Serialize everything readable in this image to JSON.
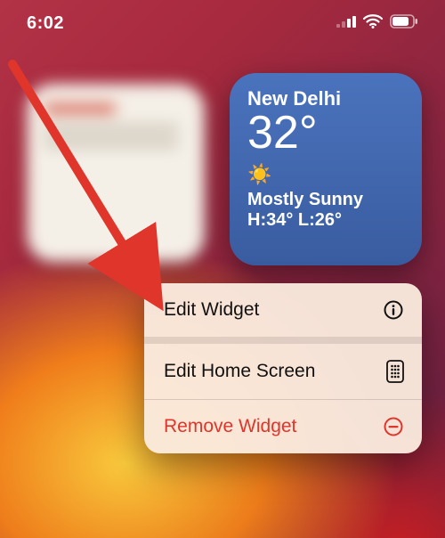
{
  "statusbar": {
    "time": "6:02"
  },
  "widgets": {
    "weather": {
      "city": "New Delhi",
      "temp": "32°",
      "condition": "Mostly Sunny",
      "high_low": "H:34° L:26°"
    }
  },
  "menu": {
    "items": [
      {
        "label": "Edit Widget",
        "destructive": false
      },
      {
        "label": "Edit Home Screen",
        "destructive": false
      },
      {
        "label": "Remove Widget",
        "destructive": true
      }
    ]
  },
  "annotation": {
    "arrow_target": "edit-widget-menu-item",
    "color": "#e0352b"
  }
}
